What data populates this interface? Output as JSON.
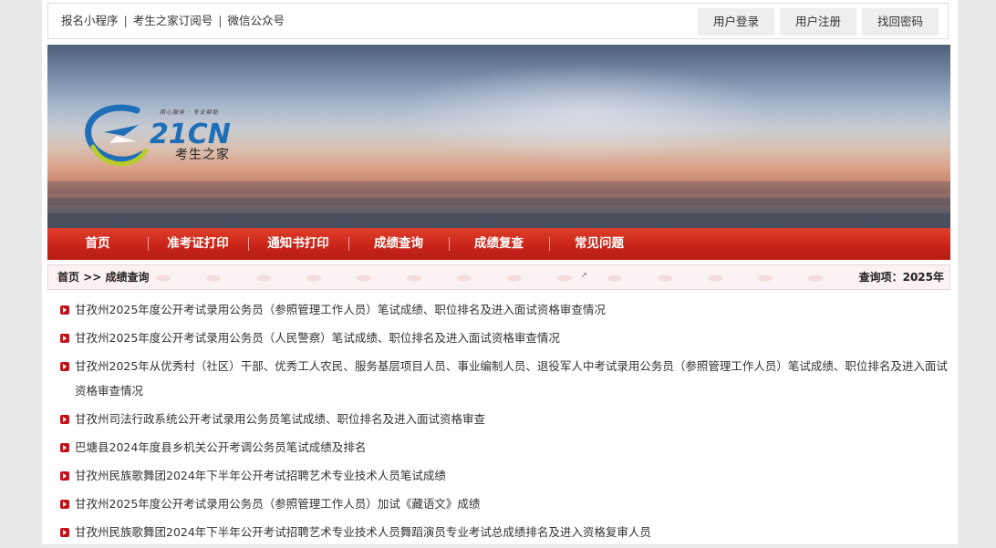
{
  "topbar": {
    "links": [
      "报名小程序",
      "考生之家订阅号",
      "微信公众号"
    ],
    "separator": "|",
    "buttons": {
      "login": "用户登录",
      "register": "用户注册",
      "recover": "找回密码"
    }
  },
  "banner": {
    "logo_text": "考生之家",
    "logo_mark": "21CN",
    "logo_slogan": "用心服务 · 专业帮助"
  },
  "nav": {
    "items": [
      "首页",
      "准考证打印",
      "通知书打印",
      "成绩查询",
      "成绩复查",
      "常见问题"
    ]
  },
  "breadcrumb": {
    "home": "首页",
    "arrow": ">>",
    "current": "成绩查询",
    "query_label": "查询项：",
    "query_value": "2025年"
  },
  "list": {
    "items": [
      "甘孜州2025年度公开考试录用公务员（参照管理工作人员）笔试成绩、职位排名及进入面试资格审查情况",
      "甘孜州2025年度公开考试录用公务员（人民警察）笔试成绩、职位排名及进入面试资格审查情况",
      "甘孜州2025年从优秀村（社区）干部、优秀工人农民、服务基层项目人员、事业编制人员、退役军人中考试录用公务员（参照管理工作人员）笔试成绩、职位排名及进入面试资格审查情况",
      "甘孜州司法行政系统公开考试录用公务员笔试成绩、职位排名及进入面试资格审查",
      "巴塘县2024年度县乡机关公开考调公务员笔试成绩及排名",
      "甘孜州民族歌舞团2024年下半年公开考试招聘艺术专业技术人员笔试成绩",
      "甘孜州2025年度公开考试录用公务员（参照管理工作人员）加试《藏语文》成绩",
      "甘孜州民族歌舞团2024年下半年公开考试招聘艺术专业技术人员舞蹈演员专业考试总成绩排名及进入资格复审人员"
    ]
  },
  "colors": {
    "nav_red": "#c9241a",
    "bullet_red": "#c1121b"
  }
}
